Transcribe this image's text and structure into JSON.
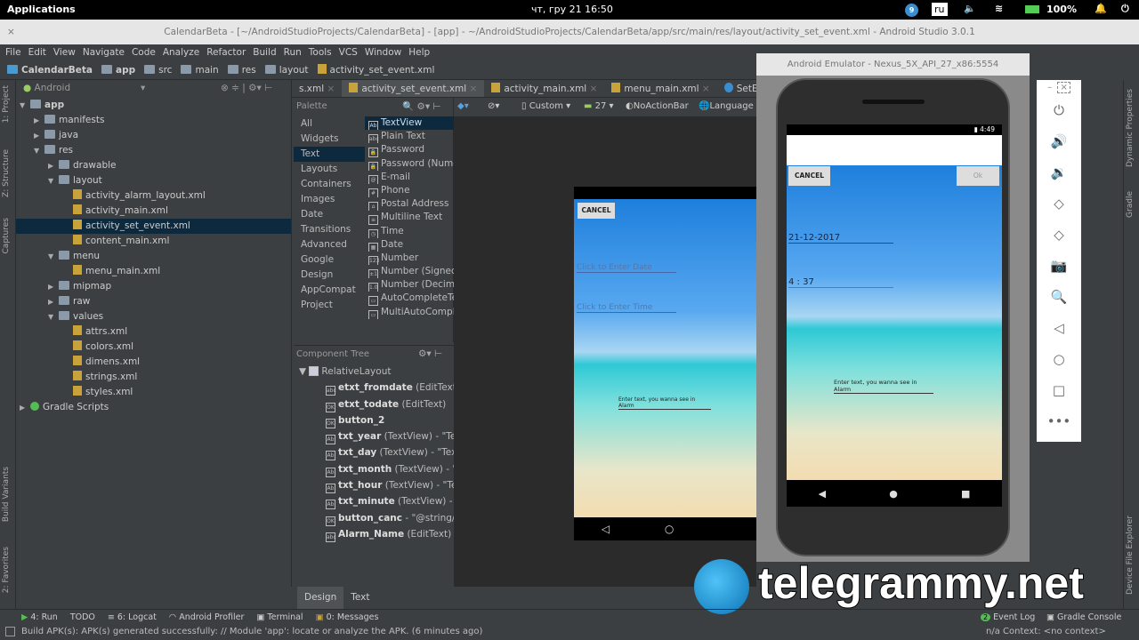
{
  "topbar": {
    "applications": "Applications",
    "datetime": "чт, гру 21   16:50",
    "lang": "ru",
    "badge": "9",
    "battery": "100%"
  },
  "window_title": "CalendarBeta - [~/AndroidStudioProjects/CalendarBeta] - [app] - ~/AndroidStudioProjects/CalendarBeta/app/src/main/res/layout/activity_set_event.xml - Android Studio 3.0.1",
  "menu": [
    "File",
    "Edit",
    "View",
    "Navigate",
    "Code",
    "Analyze",
    "Refactor",
    "Build",
    "Run",
    "Tools",
    "VCS",
    "Window",
    "Help"
  ],
  "breadcrumb": [
    "CalendarBeta",
    "app",
    "src",
    "main",
    "res",
    "layout",
    "activity_set_event.xml"
  ],
  "left_strip": [
    "1: Project",
    "Z: Structure",
    "Captures",
    "Build Variants",
    "2: Favorites"
  ],
  "right_strip": [
    "Dynamic Properties",
    "Gradle",
    "Device File Explorer"
  ],
  "project": {
    "view": "Android",
    "tree": [
      {
        "label": "app",
        "depth": 0,
        "open": true,
        "type": "folder"
      },
      {
        "label": "manifests",
        "depth": 1,
        "open": false,
        "type": "folder"
      },
      {
        "label": "java",
        "depth": 1,
        "open": false,
        "type": "folder"
      },
      {
        "label": "res",
        "depth": 1,
        "open": true,
        "type": "folder"
      },
      {
        "label": "drawable",
        "depth": 2,
        "open": false,
        "type": "folder"
      },
      {
        "label": "layout",
        "depth": 2,
        "open": true,
        "type": "folder"
      },
      {
        "label": "activity_alarm_layout.xml",
        "depth": 3,
        "type": "xml"
      },
      {
        "label": "activity_main.xml",
        "depth": 3,
        "type": "xml"
      },
      {
        "label": "activity_set_event.xml",
        "depth": 3,
        "type": "xml",
        "selected": true
      },
      {
        "label": "content_main.xml",
        "depth": 3,
        "type": "xml"
      },
      {
        "label": "menu",
        "depth": 2,
        "open": true,
        "type": "folder"
      },
      {
        "label": "menu_main.xml",
        "depth": 3,
        "type": "xml"
      },
      {
        "label": "mipmap",
        "depth": 2,
        "open": false,
        "type": "folder"
      },
      {
        "label": "raw",
        "depth": 2,
        "open": false,
        "type": "folder"
      },
      {
        "label": "values",
        "depth": 2,
        "open": true,
        "type": "folder"
      },
      {
        "label": "attrs.xml",
        "depth": 3,
        "type": "xml"
      },
      {
        "label": "colors.xml",
        "depth": 3,
        "type": "xml"
      },
      {
        "label": "dimens.xml",
        "depth": 3,
        "type": "xml"
      },
      {
        "label": "strings.xml",
        "depth": 3,
        "type": "xml"
      },
      {
        "label": "styles.xml",
        "depth": 3,
        "type": "xml"
      },
      {
        "label": "Gradle Scripts",
        "depth": 0,
        "open": false,
        "type": "gradle"
      }
    ]
  },
  "tabs": [
    {
      "label": "s.xml"
    },
    {
      "label": "activity_set_event.xml",
      "active": true
    },
    {
      "label": "activity_main.xml"
    },
    {
      "label": "menu_main.xml"
    },
    {
      "label": "SetEvent.java"
    }
  ],
  "design_toolbar": {
    "device": "Custom",
    "api": "27",
    "theme": "NoActionBar",
    "language": "Language"
  },
  "palette": {
    "title": "Palette",
    "categories": [
      "All",
      "Widgets",
      "Text",
      "Layouts",
      "Containers",
      "Images",
      "Date",
      "Transitions",
      "Advanced",
      "Google",
      "Design",
      "AppCompat",
      "Project"
    ],
    "selected_category": "Text",
    "items": [
      {
        "icon": "Ab",
        "label": "TextView"
      },
      {
        "icon": "abc",
        "label": "Plain Text"
      },
      {
        "icon": "🔒",
        "label": "Password"
      },
      {
        "icon": "🔒",
        "label": "Password (Numer"
      },
      {
        "icon": "@",
        "label": "E-mail"
      },
      {
        "icon": "#",
        "label": "Phone"
      },
      {
        "icon": "⌂",
        "label": "Postal Address"
      },
      {
        "icon": "≡",
        "label": "Multiline Text"
      },
      {
        "icon": "◷",
        "label": "Time"
      },
      {
        "icon": "▦",
        "label": "Date"
      },
      {
        "icon": "123",
        "label": "Number"
      },
      {
        "icon": "±1",
        "label": "Number (Signed)"
      },
      {
        "icon": "1.0",
        "label": "Number (Decimal"
      },
      {
        "icon": "▭",
        "label": "AutoCompleteTex"
      },
      {
        "icon": "▭",
        "label": "MultiAutoComplet"
      }
    ]
  },
  "component_tree": {
    "title": "Component Tree",
    "root": "RelativeLayout",
    "items": [
      {
        "icon": "abc",
        "id": "etxt_fromdate",
        "type": " (EditText)"
      },
      {
        "icon": "OK",
        "id": "etxt_todate",
        "type": " (EditText)"
      },
      {
        "icon": "OK",
        "id": "button_2",
        "type": ""
      },
      {
        "icon": "Ab",
        "id": "txt_year",
        "type": " (TextView) - \"TextVi"
      },
      {
        "icon": "Ab",
        "id": "txt_day",
        "type": " (TextView) - \"TextVie"
      },
      {
        "icon": "Ab",
        "id": "txt_month",
        "type": " (TextView) - \"Tex"
      },
      {
        "icon": "Ab",
        "id": "txt_hour",
        "type": " (TextView) - \"TextV"
      },
      {
        "icon": "Ab",
        "id": "txt_minute",
        "type": " (TextView) - \"Te"
      },
      {
        "icon": "OK",
        "id": "button_canc",
        "type": " - \"@string/canc"
      },
      {
        "icon": "abc",
        "id": "Alarm_Name",
        "type": " (EditText) - \"@"
      }
    ]
  },
  "preview": {
    "cancel": "CANCEL",
    "date_hint": "Click to Enter Date",
    "time_hint": "Click to Enter Time",
    "alarm_hint": "Enter text, you wanna see in Alarm"
  },
  "design_tabs": [
    "Design",
    "Text"
  ],
  "emulator": {
    "title": "Android Emulator - Nexus_5X_API_27_x86:5554",
    "clock": "4:49",
    "cancel": "CANCEL",
    "ok": "Ok",
    "date": "21-12-2017",
    "time": "4 : 37",
    "alarm_hint": "Enter text, you wanna see in Alarm"
  },
  "emu_side": [
    "⏻",
    "🔊",
    "🔉",
    "◇",
    "◇",
    "📷",
    "🔍",
    "◁",
    "○",
    "□",
    "•••"
  ],
  "bottom_tools": [
    "4: Run",
    "TODO",
    "6: Logcat",
    "Android Profiler",
    "Terminal",
    "0: Messages"
  ],
  "bottom_right": {
    "event_log": "Event Log",
    "event_count": "2",
    "gradle_console": "Gradle Console"
  },
  "status": {
    "message": "Build APK(s): APK(s) generated successfully: // Module 'app': locate or analyze the APK. (6 minutes ago)",
    "right": "n/a   Context: <no context>"
  },
  "watermark": "telegrammy.net"
}
